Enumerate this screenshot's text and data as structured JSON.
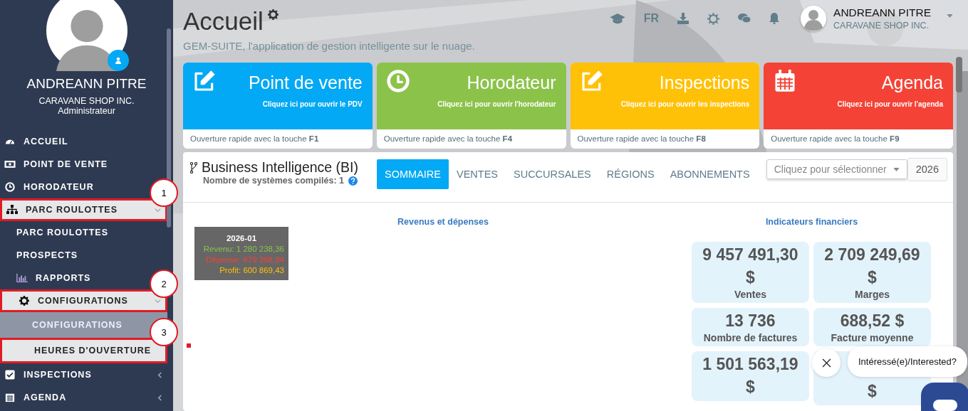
{
  "sidebar": {
    "user": {
      "name": "ANDREANN PITRE",
      "company": "CARAVANE SHOP INC.",
      "role": "Administrateur"
    },
    "items": [
      {
        "label": "ACCUEIL",
        "highlighted": false,
        "selected": false
      },
      {
        "label": "POINT DE VENTE",
        "highlighted": false,
        "selected": false
      },
      {
        "label": "HORODATEUR",
        "highlighted": false,
        "selected": false
      },
      {
        "label": "PARC ROULOTTES",
        "highlighted": true,
        "selected": false,
        "expanded": true,
        "callout": "1",
        "children": [
          {
            "label": "PARC ROULOTTES",
            "highlighted": false,
            "selected": false
          },
          {
            "label": "PROSPECTS",
            "highlighted": false,
            "selected": false
          },
          {
            "label": "RAPPORTS",
            "highlighted": false,
            "selected": false
          },
          {
            "label": "CONFIGURATIONS",
            "highlighted": true,
            "selected": false,
            "expanded": true,
            "callout": "2",
            "children": [
              {
                "label": "CONFIGURATIONS",
                "highlighted": false,
                "selected": true
              },
              {
                "label": "HEURES D'OUVERTURE",
                "highlighted": true,
                "selected": false,
                "callout": "3"
              }
            ]
          }
        ]
      },
      {
        "label": "INSPECTIONS",
        "highlighted": false,
        "selected": false,
        "expanded": false
      },
      {
        "label": "AGENDA",
        "highlighted": false,
        "selected": false,
        "expanded": false
      }
    ]
  },
  "header": {
    "title": "Accueil",
    "subtitle": "GEM-SUITE, l'application de gestion intelligente sur le nuage.",
    "language": "FR",
    "user": {
      "name": "ANDREANN PITRE",
      "company": "CARAVANE SHOP INC."
    }
  },
  "tiles": [
    {
      "title": "Point de vente",
      "subtitle": "Cliquez ici pour ouvrir le PDV",
      "footer": "Ouverture rapide avec la touche **F1**",
      "color": "#03a9f4"
    },
    {
      "title": "Horodateur",
      "subtitle": "Cliquez ici pour ouvrir l'horodateur",
      "footer": "Ouverture rapide avec la touche **F4**",
      "color": "#8bc34a"
    },
    {
      "title": "Inspections",
      "subtitle": "Cliquez ici pour ouvrir les inspections",
      "footer": "Ouverture rapide avec la touche **F8**",
      "color": "#ffc107"
    },
    {
      "title": "Agenda",
      "subtitle": "Cliquez ici pour ouvrir l'agenda",
      "footer": "Ouverture rapide avec la touche **F9**",
      "color": "#f44336"
    }
  ],
  "bi": {
    "title": "Business Intelligence (BI)",
    "compiled": "Nombre de systèmes compilés: 1",
    "tabs": [
      {
        "label": "SOMMAIRE",
        "selected": true
      },
      {
        "label": "VENTES",
        "selected": false
      },
      {
        "label": "SUCCURSALES",
        "selected": false
      },
      {
        "label": "RÉGIONS",
        "selected": false
      },
      {
        "label": "ABONNEMENTS",
        "selected": false
      }
    ],
    "select": {
      "placeholder": "Cliquez pour sélectionner"
    },
    "year": "2026",
    "chart": {
      "title": "Revenus et dépenses",
      "tooltip": {
        "title": "2026-01",
        "lines": [
          {
            "text": "Revenu: 1 280 238,36",
            "color": "#8bc34a"
          },
          {
            "text": "Dépense: 679 368,94",
            "color": "#f44336"
          },
          {
            "text": "Profit: 600 869,43",
            "color": "#ffc107"
          }
        ]
      }
    },
    "indicators": {
      "title": "Indicateurs financiers",
      "cards": [
        {
          "value": "9 457 491,30 $",
          "label": "Ventes"
        },
        {
          "value": "2 709 249,69 $",
          "label": "Marges"
        },
        {
          "value": "13 736",
          "label": "Nombre de factures"
        },
        {
          "value": "688,52 $",
          "label": "Facture moyenne"
        },
        {
          "value": "1 501 563,19 $"
        },
        {
          "value": "$"
        }
      ]
    }
  },
  "chat": {
    "prompt": "Intéressé(e)/Interested?"
  }
}
